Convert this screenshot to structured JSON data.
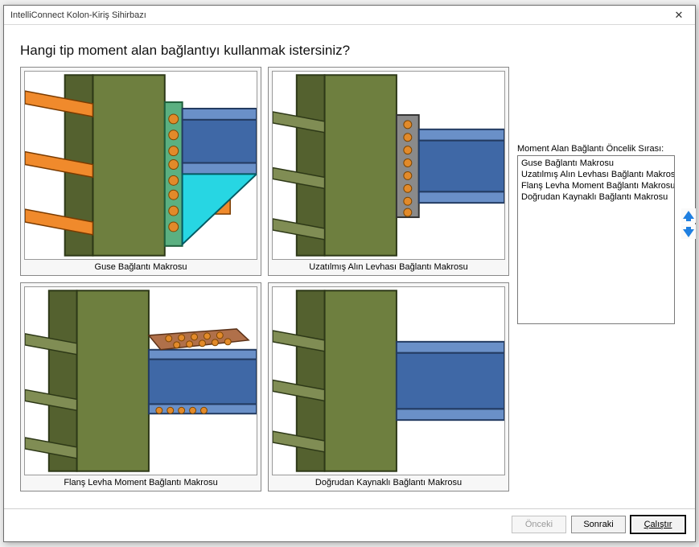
{
  "title": "IntelliConnect Kolon-Kiriş Sihirbazı",
  "question": "Hangi tip moment alan bağlantıyı kullanmak istersiniz?",
  "options": [
    {
      "label": "Guse Bağlantı Makrosu"
    },
    {
      "label": "Uzatılmış Alın Levhası Bağlantı Makrosu"
    },
    {
      "label": "Flanş Levha Moment Bağlantı Makrosu"
    },
    {
      "label": "Doğrudan Kaynaklı Bağlantı Makrosu"
    }
  ],
  "priority": {
    "legend": "Moment Alan Bağlantı Öncelik Sırası:",
    "items": [
      "Guse Bağlantı Makrosu",
      "Uzatılmış Alın Levhası Bağlantı Makrosu",
      "Flanş Levha Moment Bağlantı Makrosu",
      "Doğrudan Kaynaklı Bağlantı Makrosu"
    ]
  },
  "buttons": {
    "prev": "Önceki",
    "next": "Sonraki",
    "run": "Çalıştır"
  }
}
